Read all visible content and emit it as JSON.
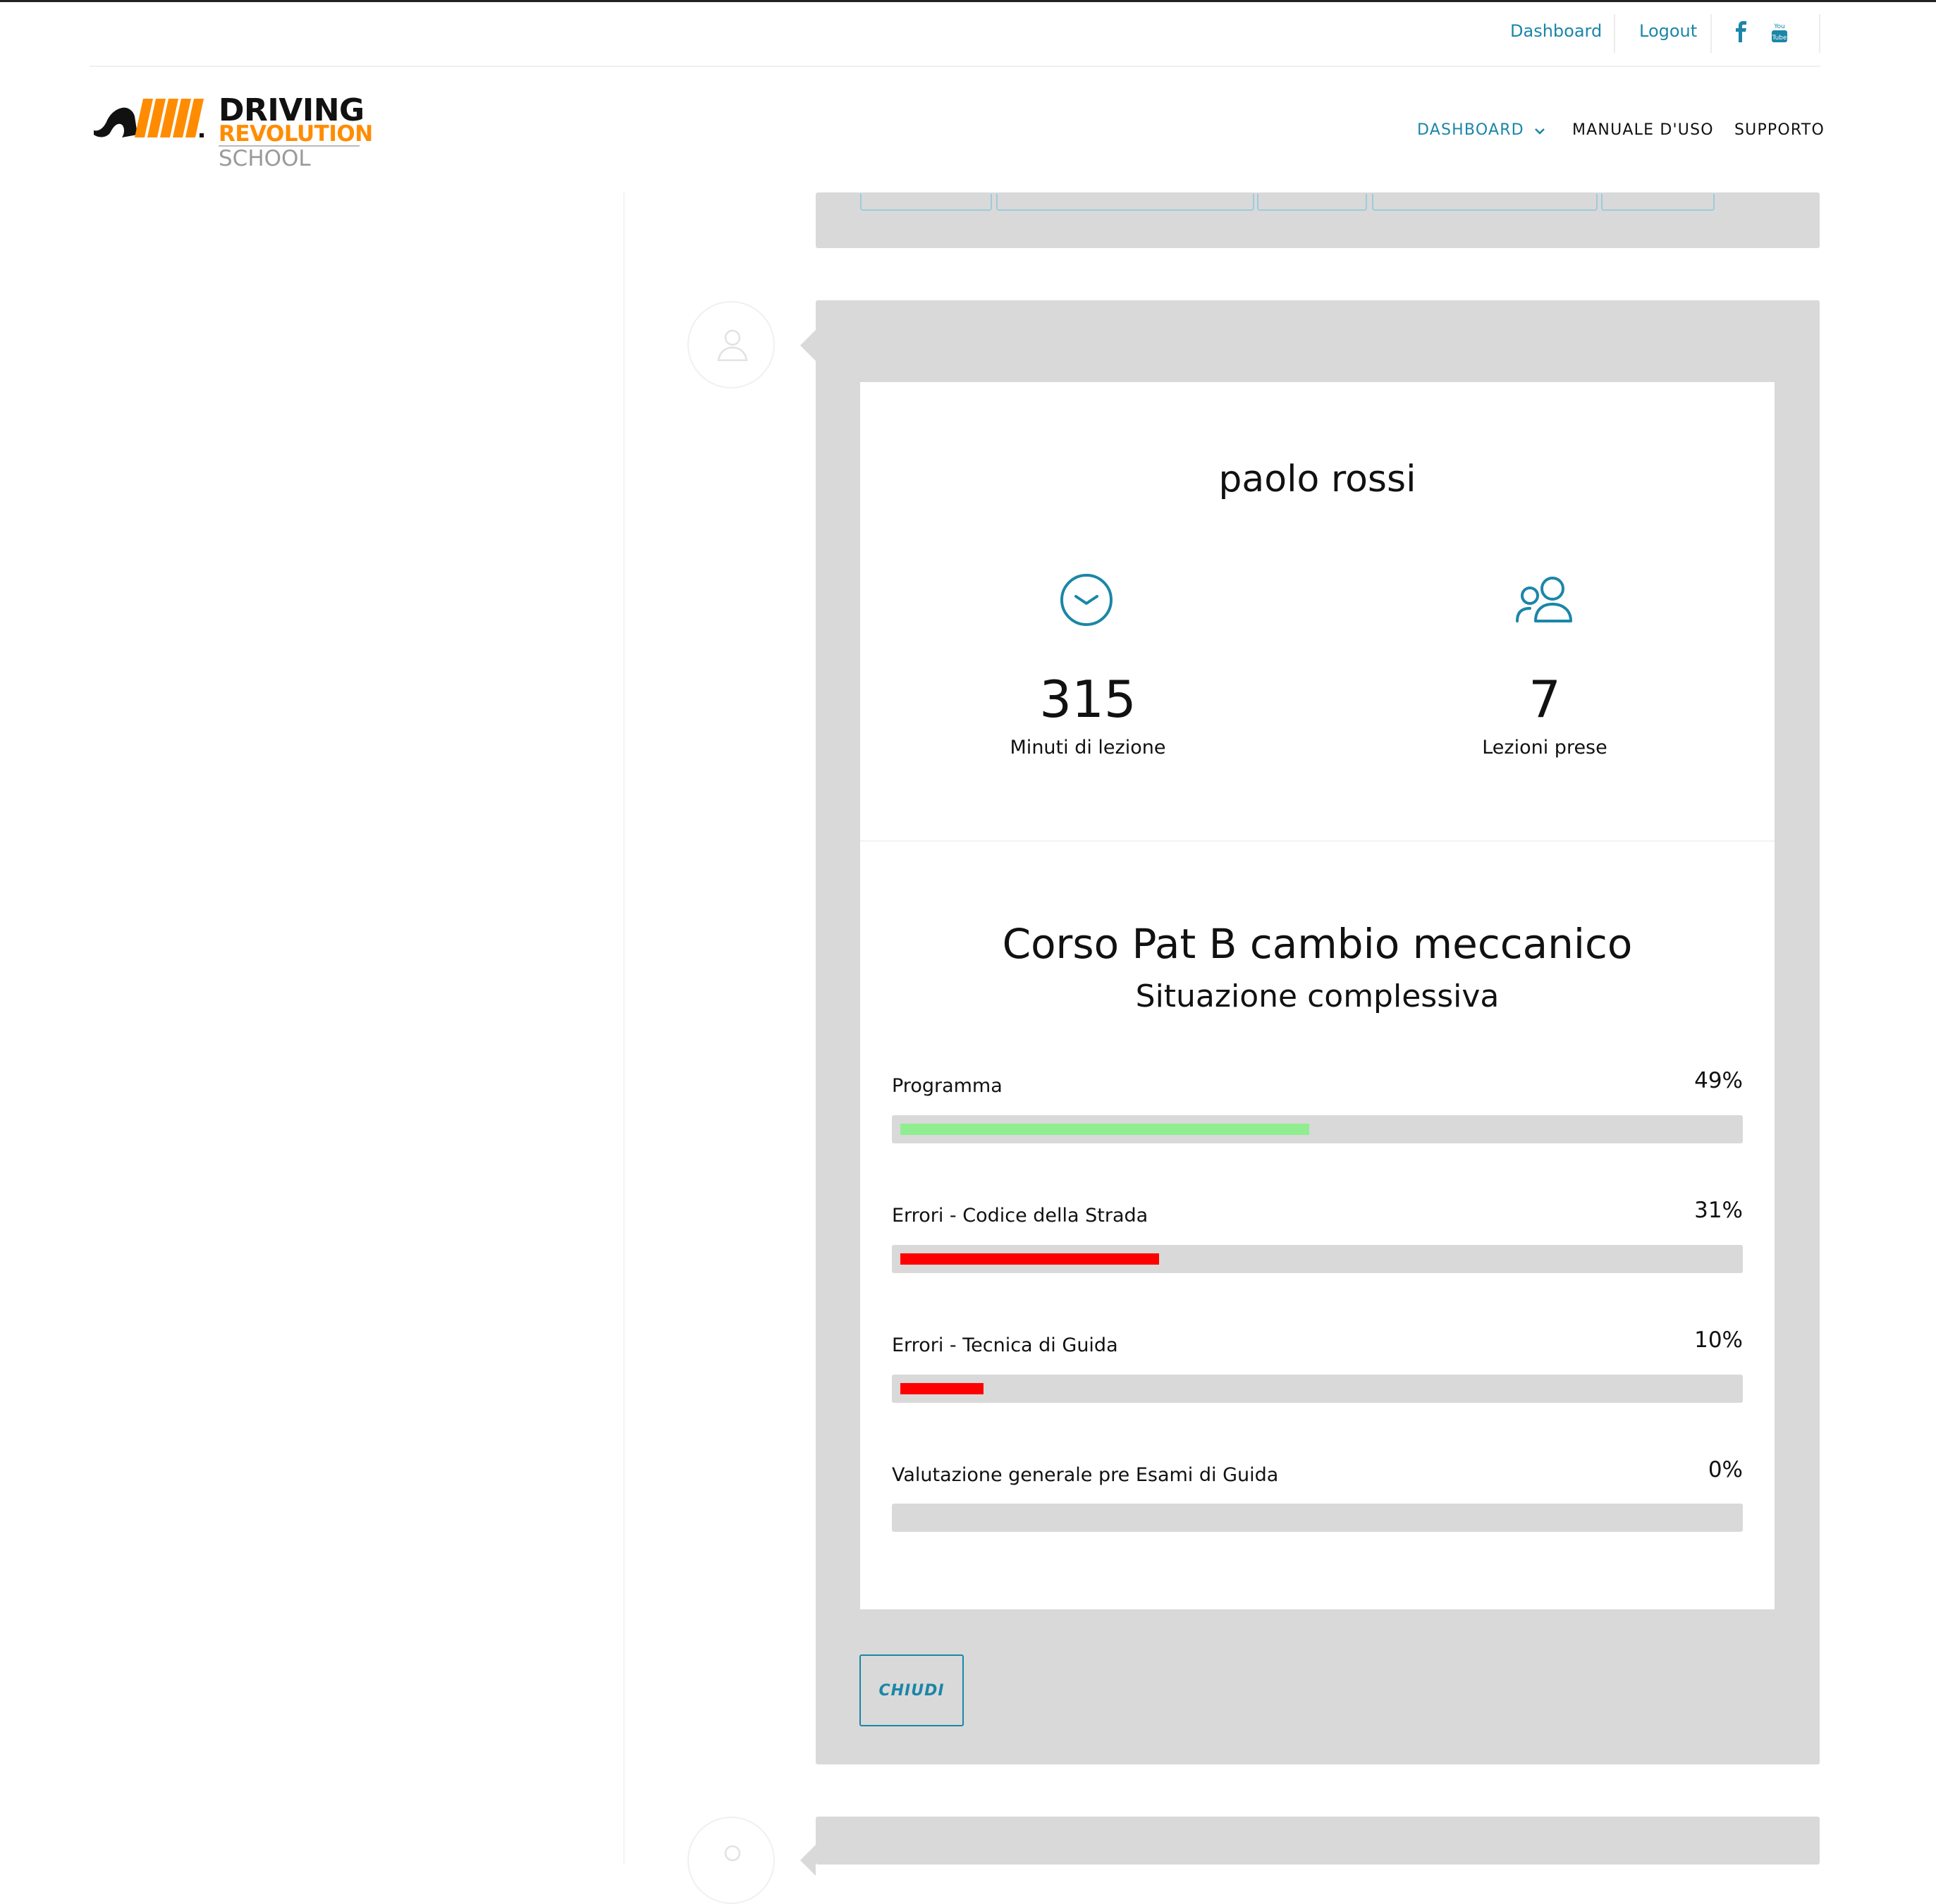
{
  "topbar": {
    "dashboard_link": "Dashboard",
    "logout_link": "Logout"
  },
  "logo": {
    "line1": "DRIVING",
    "line2": "REVOLUTION",
    "line3": "SCHOOL"
  },
  "nav": {
    "items": [
      {
        "label": "DASHBOARD",
        "active": true
      },
      {
        "label": "MANUALE D'USO",
        "active": false
      },
      {
        "label": "SUPPORTO",
        "active": false
      }
    ]
  },
  "student": {
    "name": "paolo rossi",
    "stats": [
      {
        "value": "315",
        "label": "Minuti di lezione",
        "icon": "clock-icon"
      },
      {
        "value": "7",
        "label": "Lezioni prese",
        "icon": "users-icon"
      }
    ]
  },
  "course": {
    "title": "Corso Pat B cambio meccanico",
    "subtitle": "Situazione complessiva",
    "progress": [
      {
        "label": "Programma",
        "value_text": "49%",
        "percent": 49,
        "color": "#90ee90"
      },
      {
        "label": "Errori - Codice della Strada",
        "value_text": "31%",
        "percent": 31,
        "color": "#ff0000"
      },
      {
        "label": "Errori - Tecnica di Guida",
        "value_text": "10%",
        "percent": 10,
        "color": "#ff0000"
      },
      {
        "label": "Valutazione generale pre Esami di Guida",
        "value_text": "0%",
        "percent": 0,
        "color": "#ff0000"
      }
    ]
  },
  "actions": {
    "close_label": "CHIUDI"
  },
  "colors": {
    "accent": "#1b86a8",
    "panel": "#d9d9d9"
  }
}
